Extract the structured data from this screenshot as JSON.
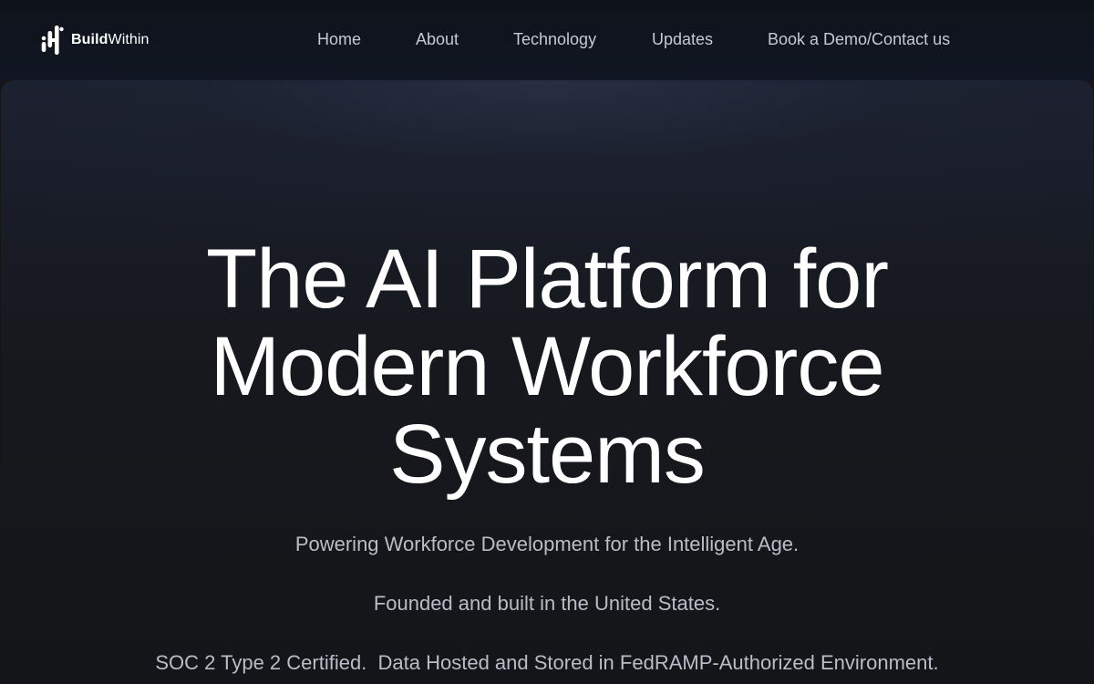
{
  "brand": {
    "name_bold": "Build",
    "name_light": "Within"
  },
  "nav": {
    "items": [
      {
        "label": "Home"
      },
      {
        "label": "About"
      },
      {
        "label": "Technology"
      },
      {
        "label": "Updates"
      },
      {
        "label": "Book a Demo/Contact us"
      }
    ]
  },
  "hero": {
    "title_lines": [
      "The AI Platform for",
      "Modern Workforce",
      "Systems"
    ],
    "tagline": "Powering Workforce Development for the Intelligent Age.",
    "founded": "Founded and built in the United States.",
    "compliance": "SOC 2 Type 2 Certified.  Data Hosted and Stored in FedRAMP-Authorized Environment."
  },
  "colors": {
    "header_bg": "#0e121b",
    "page_bg": "#15161a",
    "title_text": "#ffffff",
    "nav_text": "#c5c9d2",
    "body_text": "#b9bdc6"
  }
}
